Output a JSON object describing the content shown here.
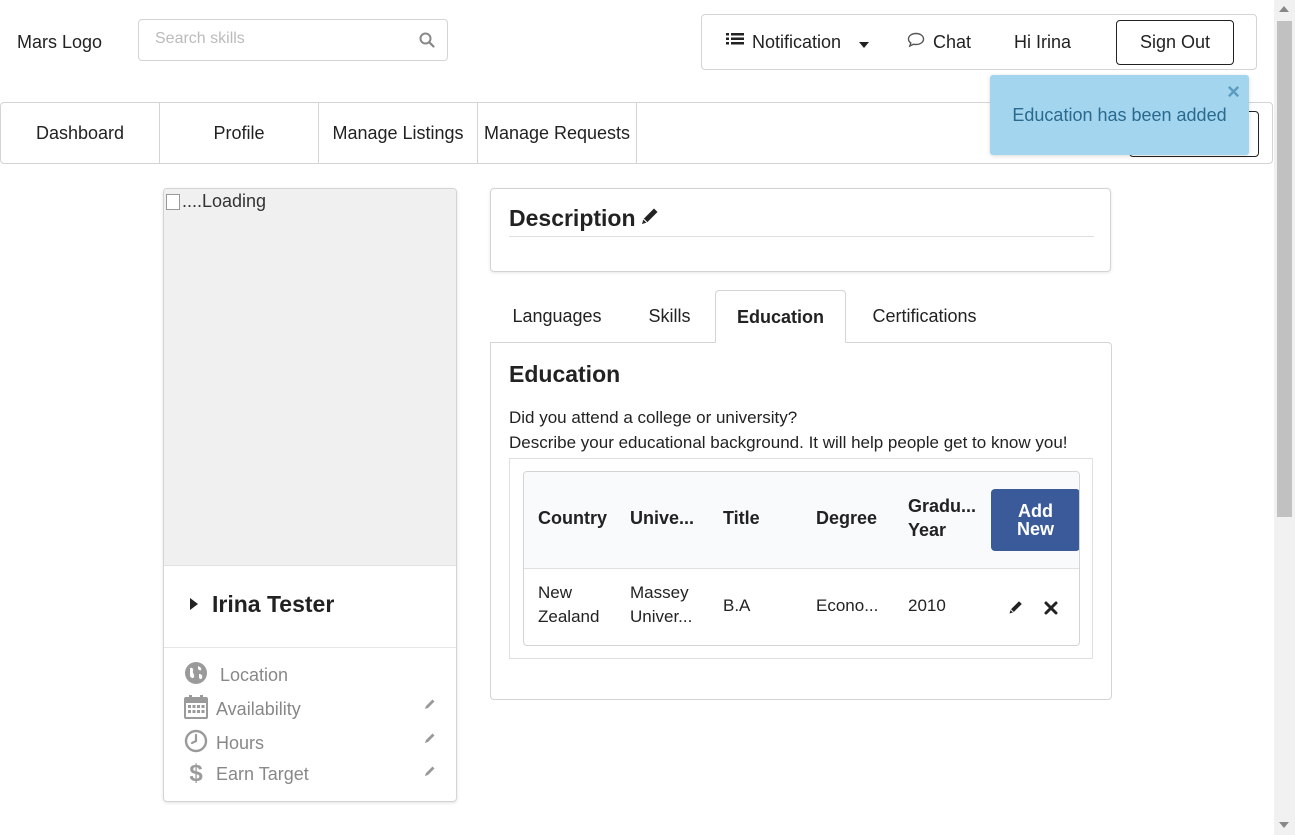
{
  "header": {
    "logo": "Mars Logo",
    "search_placeholder": "Search skills",
    "notification_label": "Notification",
    "chat_label": "Chat",
    "greeting": "Hi Irina",
    "signout_label": "Sign Out"
  },
  "nav": {
    "items": [
      {
        "label": "Dashboard"
      },
      {
        "label": "Profile"
      },
      {
        "label": "Manage Listings"
      },
      {
        "label": "Manage Requests"
      }
    ]
  },
  "toast": {
    "message": "Education has been added",
    "close": "×"
  },
  "profile": {
    "photo_alt": "....Loading",
    "name": "Irina Tester",
    "location_label": "Location",
    "availability_label": "Availability",
    "hours_label": "Hours",
    "earn_target_label": "Earn Target"
  },
  "description": {
    "title": "Description"
  },
  "tabs": {
    "items": [
      {
        "label": "Languages"
      },
      {
        "label": "Skills"
      },
      {
        "label": "Education"
      },
      {
        "label": "Certifications"
      }
    ],
    "active": "Education"
  },
  "education": {
    "title": "Education",
    "intro_1": "Did you attend a college or university?",
    "intro_2": "Describe your educational background. It will help people get to know you!",
    "columns": [
      "Country",
      "Unive...",
      "Title",
      "Degree",
      "Gradu...",
      "Year"
    ],
    "add_new_line1": "Add",
    "add_new_line2": "New",
    "rows": [
      {
        "country_1": "New",
        "country_2": "Zealand",
        "university_1": "Massey",
        "university_2": "Univer...",
        "title": "B.A",
        "degree": "Econo...",
        "year": "2010"
      }
    ]
  },
  "colors": {
    "toast_bg": "#a3d5ee",
    "toast_text": "#2a6a8e",
    "add_button": "#3b5a9a"
  },
  "icons": [
    "search-icon",
    "list-icon",
    "caret-down-icon",
    "chat-bubble-icon",
    "triangle-right-icon",
    "globe-icon",
    "calendar-icon",
    "clock-icon",
    "dollar-icon",
    "pencil-icon",
    "close-x-icon"
  ]
}
